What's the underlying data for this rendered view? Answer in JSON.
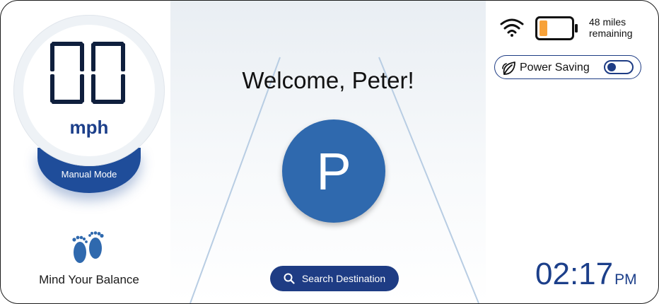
{
  "speedometer": {
    "speed": "00",
    "unit": "mph",
    "mode_label": "Manual Mode"
  },
  "balance": {
    "icon": "footprints-icon",
    "label": "Mind Your Balance"
  },
  "welcome": {
    "text": "Welcome, Peter!"
  },
  "avatar": {
    "initial": "P",
    "color": "#2f69ae"
  },
  "search": {
    "label": "Search Destination",
    "icon": "search-icon"
  },
  "status": {
    "wifi_icon": "wifi-icon",
    "battery_level": 0.25,
    "range_line1": "48 miles",
    "range_line2": "remaining"
  },
  "power_saving": {
    "label": "Power Saving",
    "enabled": false,
    "icon": "leaf-icon"
  },
  "clock": {
    "time": "02:17",
    "ampm": "PM"
  },
  "colors": {
    "accent": "#1e3c84",
    "brand_blue": "#2f69ae",
    "battery": "#f7a23a"
  }
}
